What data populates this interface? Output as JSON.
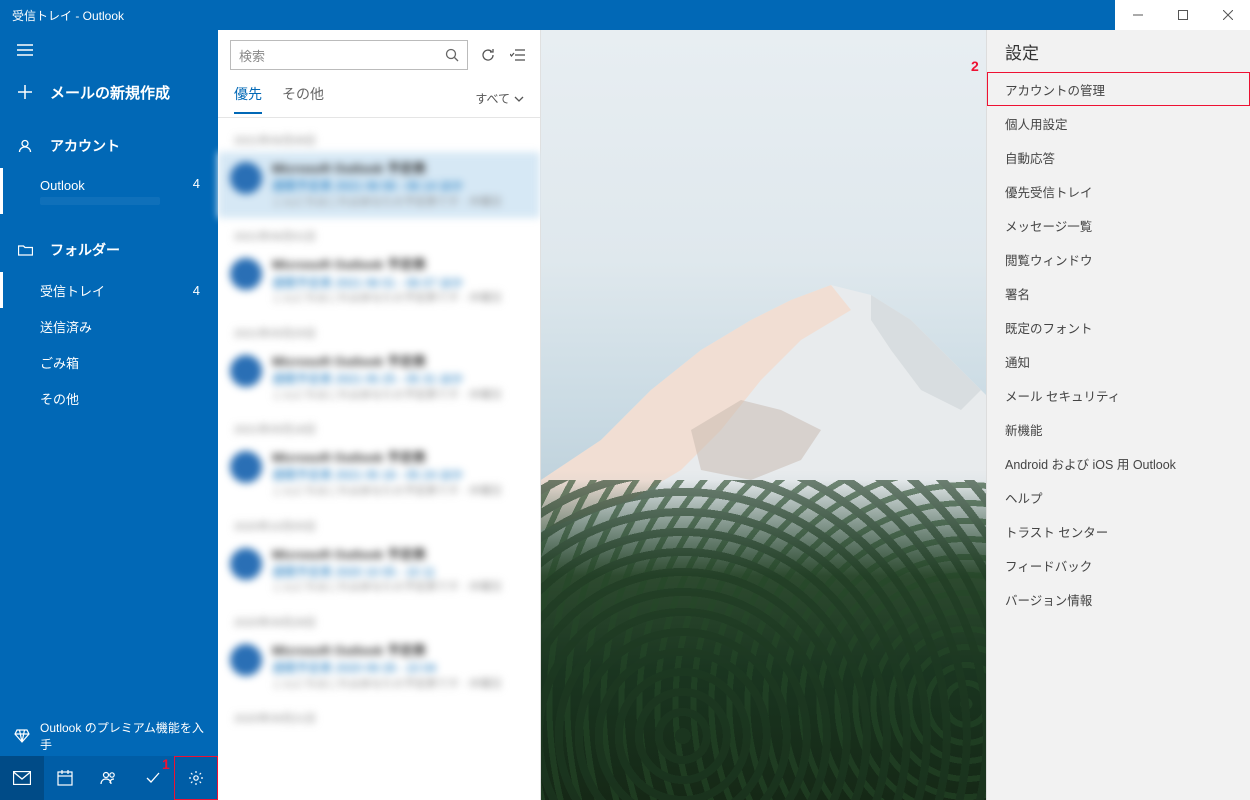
{
  "window": {
    "title": "受信トレイ - Outlook"
  },
  "sidebar": {
    "compose": "メールの新規作成",
    "account_header": "アカウント",
    "account_name": "Outlook",
    "account_badge": "4",
    "folders_header": "フォルダー",
    "folders": [
      {
        "label": "受信トレイ",
        "badge": "4"
      },
      {
        "label": "送信済み",
        "badge": ""
      },
      {
        "label": "ごみ箱",
        "badge": ""
      },
      {
        "label": "その他",
        "badge": ""
      }
    ],
    "premium": "Outlook のプレミアム機能を入手"
  },
  "search": {
    "placeholder": "検索"
  },
  "tabs": {
    "focused": "優先",
    "other": "その他",
    "filter": "すべて"
  },
  "settings": {
    "title": "設定",
    "items": [
      "アカウントの管理",
      "個人用設定",
      "自動応答",
      "優先受信トレイ",
      "メッセージ一覧",
      "閲覧ウィンドウ",
      "署名",
      "既定のフォント",
      "通知",
      "メール セキュリティ",
      "新機能",
      "Android および iOS 用 Outlook",
      "ヘルプ",
      "トラスト センター",
      "フィードバック",
      "バージョン情報"
    ]
  },
  "annotations": {
    "one": "1",
    "two": "2"
  }
}
